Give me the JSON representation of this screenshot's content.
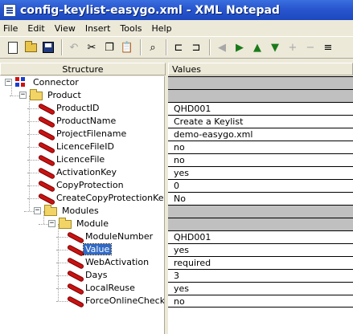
{
  "window": {
    "title": "config-keylist-easygo.xml - XML Notepad"
  },
  "menu": [
    "File",
    "Edit",
    "View",
    "Insert",
    "Tools",
    "Help"
  ],
  "toolbar": {
    "buttons": [
      {
        "name": "new-icon",
        "state": "enabled"
      },
      {
        "name": "open-icon",
        "state": "enabled"
      },
      {
        "name": "save-icon",
        "state": "enabled"
      },
      {
        "name": "undo-icon",
        "state": "disabled"
      },
      {
        "name": "cut-icon",
        "state": "enabled"
      },
      {
        "name": "copy-icon",
        "state": "enabled"
      },
      {
        "name": "paste-icon",
        "state": "enabled"
      },
      {
        "name": "find-icon",
        "state": "enabled"
      },
      {
        "name": "nudge-icon",
        "state": "enabled"
      },
      {
        "name": "move-left-icon",
        "state": "disabled"
      },
      {
        "name": "move-right-icon",
        "state": "enabled"
      },
      {
        "name": "move-up-icon",
        "state": "enabled"
      },
      {
        "name": "move-down-icon",
        "state": "enabled"
      },
      {
        "name": "add-icon",
        "state": "disabled"
      },
      {
        "name": "remove-icon",
        "state": "disabled"
      },
      {
        "name": "sort-icon",
        "state": "enabled"
      }
    ]
  },
  "headers": {
    "structure": "Structure",
    "values": "Values"
  },
  "tree": [
    {
      "label": "Connector",
      "type": "connector",
      "expander": "−",
      "value": ""
    },
    {
      "label": "Product",
      "type": "folder",
      "expander": "−",
      "value": ""
    },
    {
      "label": "ProductID",
      "type": "leaf",
      "value": "QHD001"
    },
    {
      "label": "ProductName",
      "type": "leaf",
      "value": "Create a Keylist"
    },
    {
      "label": "ProjectFilename",
      "type": "leaf",
      "value": "demo-easygo.xml"
    },
    {
      "label": "LicenceFileID",
      "type": "leaf",
      "value": "no"
    },
    {
      "label": "LicenceFile",
      "type": "leaf",
      "value": "no"
    },
    {
      "label": "ActivationKey",
      "type": "leaf",
      "value": "yes"
    },
    {
      "label": "CopyProtection",
      "type": "leaf",
      "value": "0"
    },
    {
      "label": "CreateCopyProtectionKey",
      "type": "leaf",
      "value": "No"
    },
    {
      "label": "Modules",
      "type": "folder",
      "expander": "−",
      "value": ""
    },
    {
      "label": "Module",
      "type": "folder",
      "expander": "−",
      "value": ""
    },
    {
      "label": "ModuleNumber",
      "type": "leaf",
      "value": "QHD001"
    },
    {
      "label": "Value",
      "type": "leaf",
      "value": "yes",
      "selected": true
    },
    {
      "label": "WebActivation",
      "type": "leaf",
      "value": "required"
    },
    {
      "label": "Days",
      "type": "leaf",
      "value": "3"
    },
    {
      "label": "LocalReuse",
      "type": "leaf",
      "value": "yes"
    },
    {
      "label": "ForceOnlineCheck",
      "type": "leaf",
      "value": "no"
    }
  ],
  "colors": {
    "titlebar": "#2a58d0",
    "selection": "#316ac5",
    "leaf_icon": "#c81212"
  }
}
